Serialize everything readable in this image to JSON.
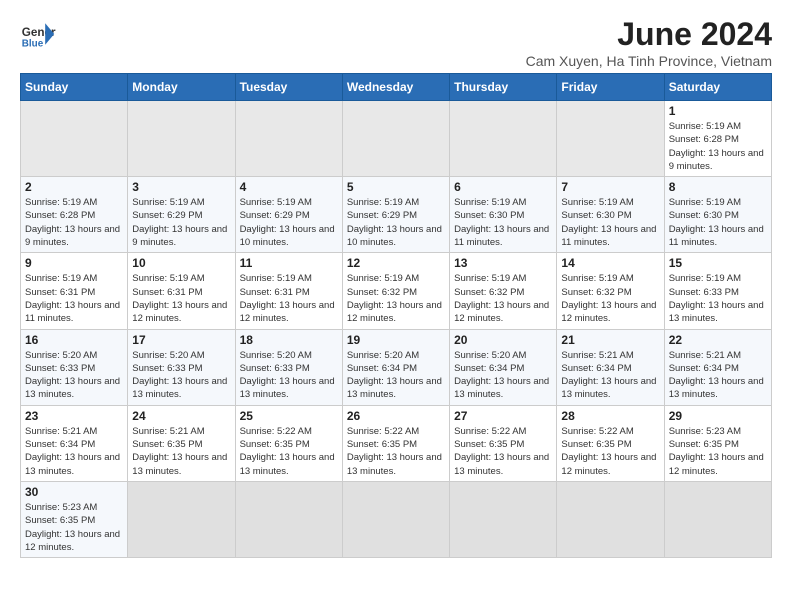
{
  "header": {
    "logo_text_regular": "General",
    "logo_text_bold": "Blue",
    "title": "June 2024",
    "subtitle": "Cam Xuyen, Ha Tinh Province, Vietnam"
  },
  "calendar": {
    "weekdays": [
      "Sunday",
      "Monday",
      "Tuesday",
      "Wednesday",
      "Thursday",
      "Friday",
      "Saturday"
    ],
    "weeks": [
      [
        {
          "day": "",
          "info": ""
        },
        {
          "day": "",
          "info": ""
        },
        {
          "day": "",
          "info": ""
        },
        {
          "day": "",
          "info": ""
        },
        {
          "day": "",
          "info": ""
        },
        {
          "day": "",
          "info": ""
        },
        {
          "day": "1",
          "info": "Sunrise: 5:19 AM\nSunset: 6:28 PM\nDaylight: 13 hours and 9 minutes."
        }
      ],
      [
        {
          "day": "2",
          "info": "Sunrise: 5:19 AM\nSunset: 6:28 PM\nDaylight: 13 hours and 9 minutes."
        },
        {
          "day": "3",
          "info": "Sunrise: 5:19 AM\nSunset: 6:29 PM\nDaylight: 13 hours and 9 minutes."
        },
        {
          "day": "4",
          "info": "Sunrise: 5:19 AM\nSunset: 6:29 PM\nDaylight: 13 hours and 10 minutes."
        },
        {
          "day": "5",
          "info": "Sunrise: 5:19 AM\nSunset: 6:29 PM\nDaylight: 13 hours and 10 minutes."
        },
        {
          "day": "6",
          "info": "Sunrise: 5:19 AM\nSunset: 6:30 PM\nDaylight: 13 hours and 11 minutes."
        },
        {
          "day": "7",
          "info": "Sunrise: 5:19 AM\nSunset: 6:30 PM\nDaylight: 13 hours and 11 minutes."
        },
        {
          "day": "8",
          "info": "Sunrise: 5:19 AM\nSunset: 6:30 PM\nDaylight: 13 hours and 11 minutes."
        }
      ],
      [
        {
          "day": "9",
          "info": "Sunrise: 5:19 AM\nSunset: 6:31 PM\nDaylight: 13 hours and 11 minutes."
        },
        {
          "day": "10",
          "info": "Sunrise: 5:19 AM\nSunset: 6:31 PM\nDaylight: 13 hours and 12 minutes."
        },
        {
          "day": "11",
          "info": "Sunrise: 5:19 AM\nSunset: 6:31 PM\nDaylight: 13 hours and 12 minutes."
        },
        {
          "day": "12",
          "info": "Sunrise: 5:19 AM\nSunset: 6:32 PM\nDaylight: 13 hours and 12 minutes."
        },
        {
          "day": "13",
          "info": "Sunrise: 5:19 AM\nSunset: 6:32 PM\nDaylight: 13 hours and 12 minutes."
        },
        {
          "day": "14",
          "info": "Sunrise: 5:19 AM\nSunset: 6:32 PM\nDaylight: 13 hours and 12 minutes."
        },
        {
          "day": "15",
          "info": "Sunrise: 5:19 AM\nSunset: 6:33 PM\nDaylight: 13 hours and 13 minutes."
        }
      ],
      [
        {
          "day": "16",
          "info": "Sunrise: 5:20 AM\nSunset: 6:33 PM\nDaylight: 13 hours and 13 minutes."
        },
        {
          "day": "17",
          "info": "Sunrise: 5:20 AM\nSunset: 6:33 PM\nDaylight: 13 hours and 13 minutes."
        },
        {
          "day": "18",
          "info": "Sunrise: 5:20 AM\nSunset: 6:33 PM\nDaylight: 13 hours and 13 minutes."
        },
        {
          "day": "19",
          "info": "Sunrise: 5:20 AM\nSunset: 6:34 PM\nDaylight: 13 hours and 13 minutes."
        },
        {
          "day": "20",
          "info": "Sunrise: 5:20 AM\nSunset: 6:34 PM\nDaylight: 13 hours and 13 minutes."
        },
        {
          "day": "21",
          "info": "Sunrise: 5:21 AM\nSunset: 6:34 PM\nDaylight: 13 hours and 13 minutes."
        },
        {
          "day": "22",
          "info": "Sunrise: 5:21 AM\nSunset: 6:34 PM\nDaylight: 13 hours and 13 minutes."
        }
      ],
      [
        {
          "day": "23",
          "info": "Sunrise: 5:21 AM\nSunset: 6:34 PM\nDaylight: 13 hours and 13 minutes."
        },
        {
          "day": "24",
          "info": "Sunrise: 5:21 AM\nSunset: 6:35 PM\nDaylight: 13 hours and 13 minutes."
        },
        {
          "day": "25",
          "info": "Sunrise: 5:22 AM\nSunset: 6:35 PM\nDaylight: 13 hours and 13 minutes."
        },
        {
          "day": "26",
          "info": "Sunrise: 5:22 AM\nSunset: 6:35 PM\nDaylight: 13 hours and 13 minutes."
        },
        {
          "day": "27",
          "info": "Sunrise: 5:22 AM\nSunset: 6:35 PM\nDaylight: 13 hours and 13 minutes."
        },
        {
          "day": "28",
          "info": "Sunrise: 5:22 AM\nSunset: 6:35 PM\nDaylight: 13 hours and 12 minutes."
        },
        {
          "day": "29",
          "info": "Sunrise: 5:23 AM\nSunset: 6:35 PM\nDaylight: 13 hours and 12 minutes."
        }
      ],
      [
        {
          "day": "30",
          "info": "Sunrise: 5:23 AM\nSunset: 6:35 PM\nDaylight: 13 hours and 12 minutes."
        },
        {
          "day": "",
          "info": ""
        },
        {
          "day": "",
          "info": ""
        },
        {
          "day": "",
          "info": ""
        },
        {
          "day": "",
          "info": ""
        },
        {
          "day": "",
          "info": ""
        },
        {
          "day": "",
          "info": ""
        }
      ]
    ]
  }
}
